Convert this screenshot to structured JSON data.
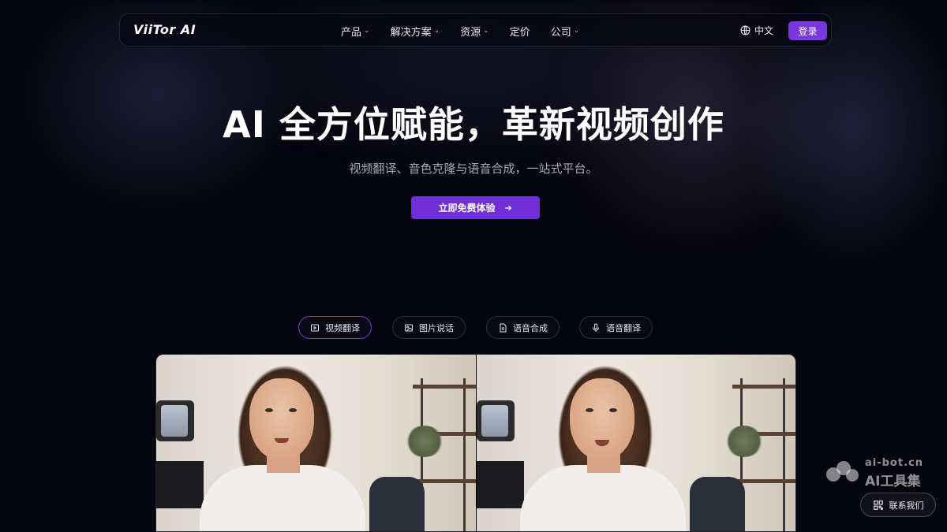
{
  "header": {
    "logo": "ViiTor AI",
    "nav": [
      {
        "label": "产品",
        "has_dropdown": true
      },
      {
        "label": "解决方案",
        "has_dropdown": true
      },
      {
        "label": "资源",
        "has_dropdown": true
      },
      {
        "label": "定价",
        "has_dropdown": false
      },
      {
        "label": "公司",
        "has_dropdown": true
      }
    ],
    "language": "中文",
    "login_label": "登录"
  },
  "hero": {
    "title": "AI 全方位赋能，革新视频创作",
    "subtitle": "视频翻译、音色克隆与语音合成，一站式平台。",
    "cta_label": "立即免费体验"
  },
  "tabs": [
    {
      "label": "视频翻译",
      "icon": "play-square-icon",
      "active": true
    },
    {
      "label": "图片说话",
      "icon": "image-icon",
      "active": false
    },
    {
      "label": "语音合成",
      "icon": "document-icon",
      "active": false
    },
    {
      "label": "语音翻译",
      "icon": "microphone-icon",
      "active": false
    }
  ],
  "watermark": {
    "line1": "ai-bot.cn",
    "line2": "AI工具集"
  },
  "contact_label": "联系我们",
  "colors": {
    "background": "#05050f",
    "accent": "#7a36e0",
    "cta": "#6f2ed8"
  }
}
